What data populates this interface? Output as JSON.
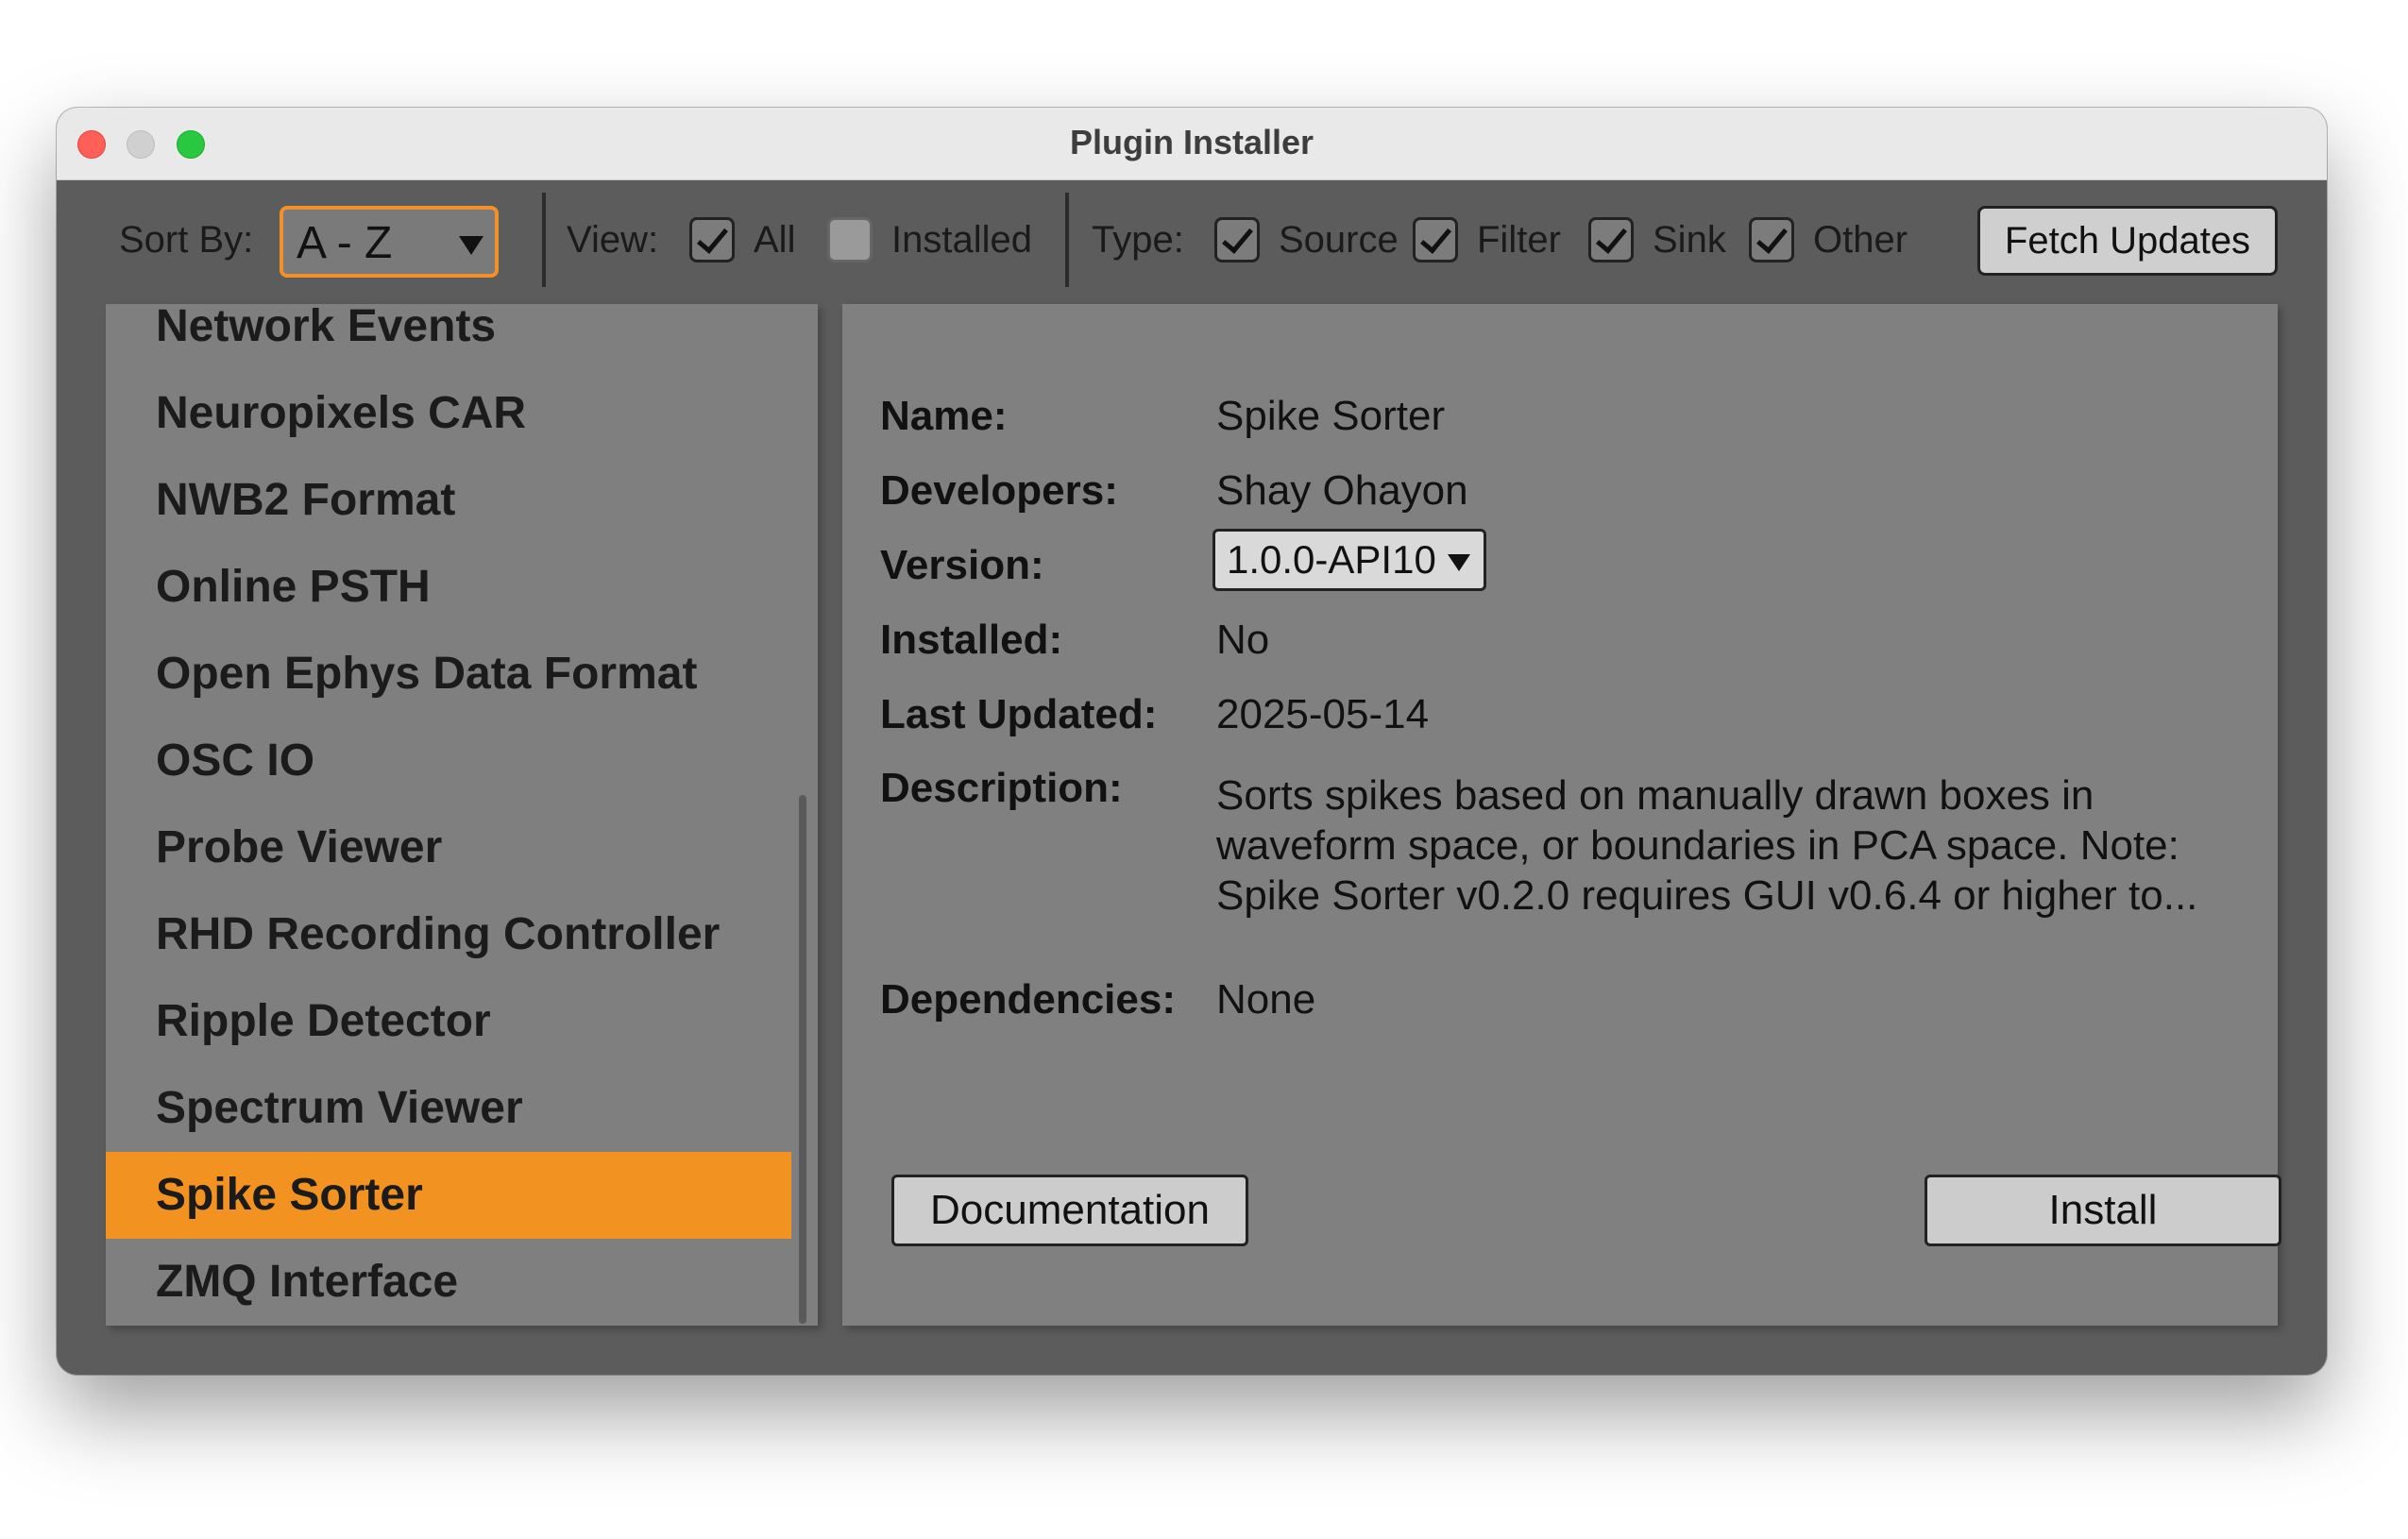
{
  "window": {
    "title": "Plugin Installer"
  },
  "toolbar": {
    "sort_label": "Sort By:",
    "sort_value": "A - Z",
    "view_label": "View:",
    "view_all_label": "All",
    "view_all_checked": true,
    "view_installed_label": "Installed",
    "view_installed_checked": false,
    "type_label": "Type:",
    "type_source_label": "Source",
    "type_filter_label": "Filter",
    "type_sink_label": "Sink",
    "type_other_label": "Other",
    "fetch_label": "Fetch Updates"
  },
  "plugin_list": {
    "items": [
      "Network Events",
      "Neuropixels CAR",
      "NWB2 Format",
      "Online PSTH",
      "Open Ephys Data Format",
      "OSC IO",
      "Probe Viewer",
      "RHD Recording Controller",
      "Ripple Detector",
      "Spectrum Viewer",
      "Spike Sorter",
      "ZMQ Interface"
    ],
    "selected": "Spike Sorter"
  },
  "details": {
    "name_label": "Name:",
    "name_value": "Spike Sorter",
    "developers_label": "Developers:",
    "developers_value": "Shay Ohayon",
    "version_label": "Version:",
    "version_value": "1.0.0-API10",
    "installed_label": "Installed:",
    "installed_value": "No",
    "last_updated_label": "Last Updated:",
    "last_updated_value": "2025-05-14",
    "description_label": "Description:",
    "description_lines": [
      "Sorts spikes based on manually drawn boxes in",
      "waveform space, or boundaries in PCA space. Note:",
      "Spike Sorter v0.2.0 requires GUI v0.6.4 or higher to..."
    ],
    "dependencies_label": "Dependencies:",
    "dependencies_value": "None",
    "documentation_label": "Documentation",
    "install_label": "Install"
  },
  "colors": {
    "accent": "#f29321",
    "window_bg": "#5c5c5c",
    "panel_bg": "#808080"
  }
}
